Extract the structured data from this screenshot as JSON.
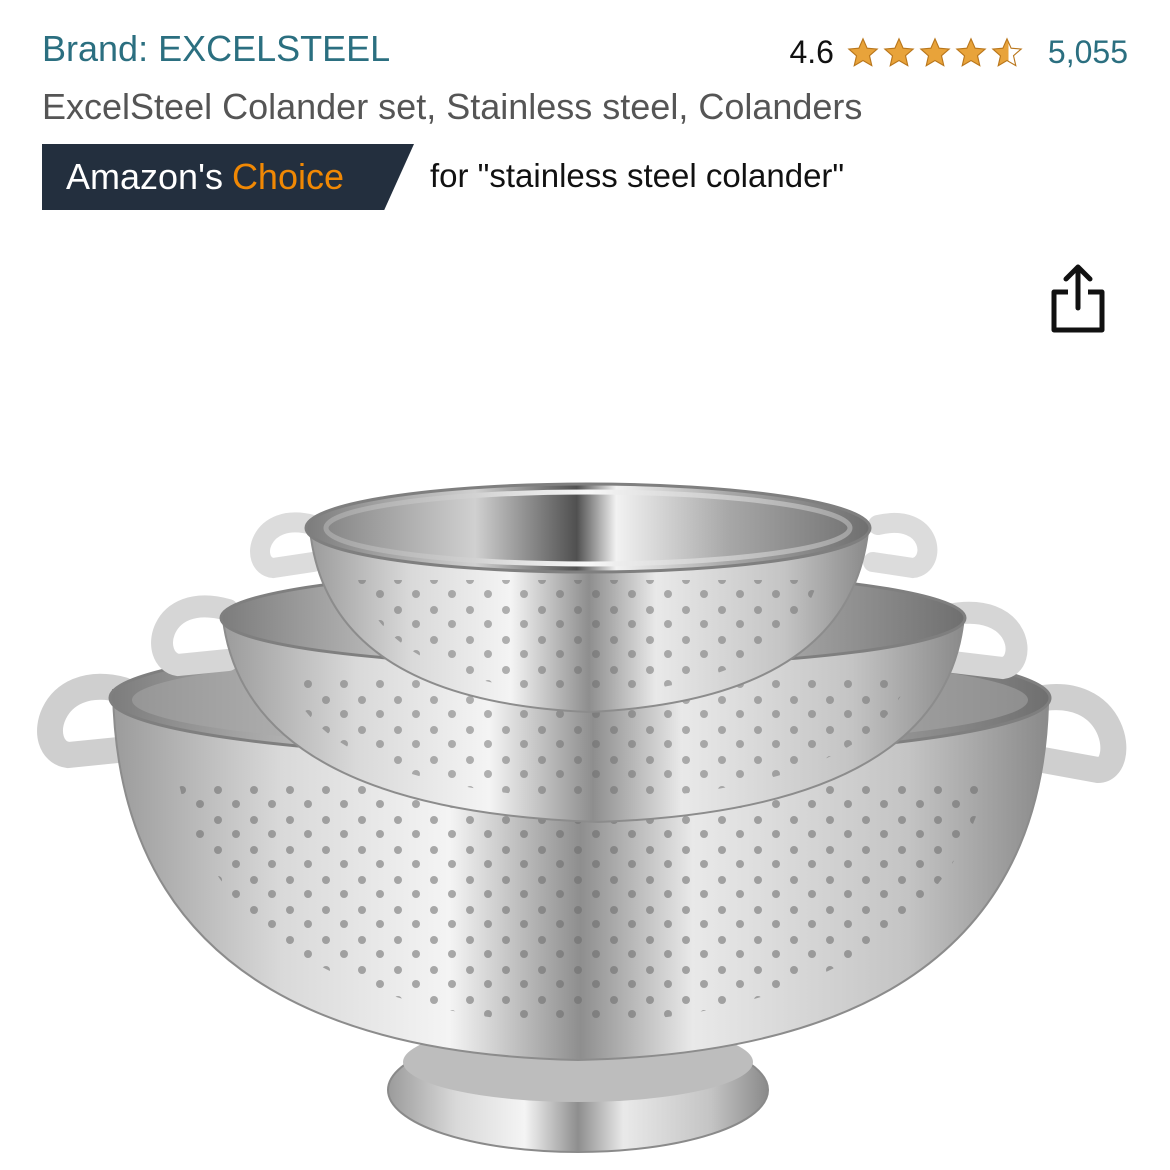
{
  "header": {
    "brand_label": "Brand: EXCELSTEEL",
    "rating_value": "4.6",
    "rating_stars": 4.6,
    "review_count": "5,055",
    "title": "ExcelSteel Colander set, Stainless steel, Colanders"
  },
  "badge": {
    "prefix": "Amazon's",
    "highlight": "Choice",
    "query": "for \"stainless steel colander\""
  },
  "colors": {
    "link": "#2b6f80",
    "star": "#e8a33a",
    "badge_bg": "#232f3e",
    "badge_accent": "#f08804"
  },
  "icons": {
    "share": "share-icon",
    "star": "star-icon"
  },
  "image": {
    "subject": "stainless-steel-colander-set"
  }
}
